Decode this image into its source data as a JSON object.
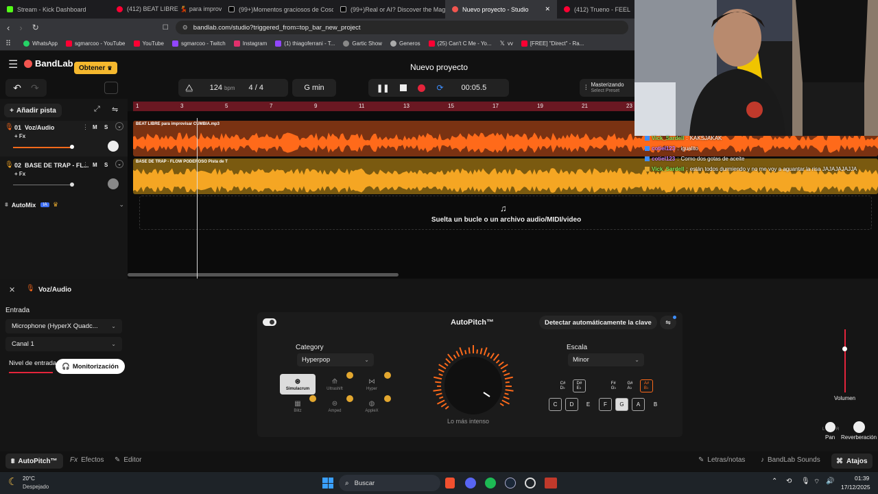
{
  "browser": {
    "tabs": [
      {
        "label": "Stream - Kick Dashboard",
        "color": "#53fc18"
      },
      {
        "label": "(412) BEAT LIBRE 💃 para improvisar",
        "color": "#ff0033"
      },
      {
        "label": "(99+)Momentos graciosos de Coscu",
        "color": "#ffffff"
      },
      {
        "label": "(99+)Real or AI? Discover the Magic",
        "color": "#ffffff"
      },
      {
        "label": "Nuevo proyecto - Studio",
        "color": "#f2554f"
      },
      {
        "label": "(412) Trueno - FEEL ME?",
        "color": "#ff0033"
      }
    ],
    "url": "bandlab.com/studio?triggered_from=top_bar_new_project",
    "bookmarks": [
      "WhatsApp",
      "sgmarcoo - YouTube",
      "YouTube",
      "sgmarcoo - Twitch",
      "Instagram",
      "(1) thiagoferrani - T...",
      "Gartic Show",
      "Generos",
      "(25) Can't C Me - Yo...",
      "vv",
      "[FREE] \"Direct\" - Ra..."
    ]
  },
  "app": {
    "brand": "BandLab",
    "get_button": "Obtener",
    "project_title": "Nuevo proyecto",
    "mastering_label": "Masterizando",
    "mastering_preset": "Select Preset",
    "bpm": "124",
    "bpm_unit": "bpm",
    "time_sig": "4 / 4",
    "key": "G min",
    "time": "00:05.5",
    "add_track": "Añadir pista",
    "tracks": [
      {
        "num": "01",
        "name": "Voz/Audio",
        "fx": "+ Fx",
        "m": "M",
        "s": "S",
        "color": "#ff6a1a"
      },
      {
        "num": "02",
        "name": "BASE DE TRAP - FL...",
        "fx": "+ Fx",
        "m": "M",
        "s": "S",
        "color": "#f5a623"
      }
    ],
    "automix": "AutoMix",
    "automix_badge": "IA",
    "timeline_ticks": [
      "1",
      "3",
      "5",
      "7",
      "9",
      "11",
      "13",
      "15",
      "17",
      "19",
      "21",
      "23"
    ],
    "clips": [
      {
        "title": "BEAT LIBRE  para improvisar CUMBIA.mp3"
      },
      {
        "title": "BASE DE TRAP - FLOW PODEROSO  Pista de T"
      }
    ],
    "drop_zone": "Suelta un bucle o un archivo audio/MIDI/video"
  },
  "panel": {
    "track_name": "Voz/Audio",
    "input_label": "Entrada",
    "input_device": "Microphone (HyperX Quadc...",
    "channel": "Canal 1",
    "level_label": "Nivel de entrada",
    "monitor_button": "Monitorización",
    "autopitch_title": "AutoPitch™",
    "detect_key": "Detectar automáticamente la clave",
    "category_label": "Category",
    "category_value": "Hyperpop",
    "effects": [
      "Simulacrum",
      "Ultrashift",
      "Hyper",
      "Blitz",
      "Amped",
      "AppleX"
    ],
    "knob_label": "Lo más intenso",
    "scale_label": "Escala",
    "scale_value": "Minor",
    "sharps": [
      "C#\nD♭",
      "D#\nE♭",
      "F#\nG♭",
      "G#\nA♭",
      "A#\nB♭"
    ],
    "naturals": [
      "C",
      "D",
      "E",
      "F",
      "G",
      "A",
      "B"
    ],
    "volume_label": "Volumen",
    "pan_label": "Pan",
    "reverb_label": "Reverberación",
    "L": "L",
    "R": "R"
  },
  "footer": {
    "tabs": [
      "AutoPitch™",
      "Efectos",
      "Editor"
    ],
    "right": [
      "Letras/notas",
      "BandLab Sounds",
      "Atajos"
    ]
  },
  "chat": [
    {
      "user": "Vick_Sardell",
      "msg": "KAKSJAKAK",
      "color": "#7ee85a"
    },
    {
      "user": "cotiel123",
      "msg": "igualito",
      "color": "#c77dff"
    },
    {
      "user": "cotiel123",
      "msg": "Como dos gotas de aceite",
      "color": "#c77dff"
    },
    {
      "user": "Vick_Sardell",
      "msg": "están todos durmiendo y no me voy a aguantar la risa JAJAJAJAJJA",
      "color": "#7ee85a"
    }
  ],
  "taskbar": {
    "weather_temp": "20°C",
    "weather_desc": "Despejado",
    "search": "Buscar",
    "time": "01:39",
    "date": "17/12/2025"
  }
}
